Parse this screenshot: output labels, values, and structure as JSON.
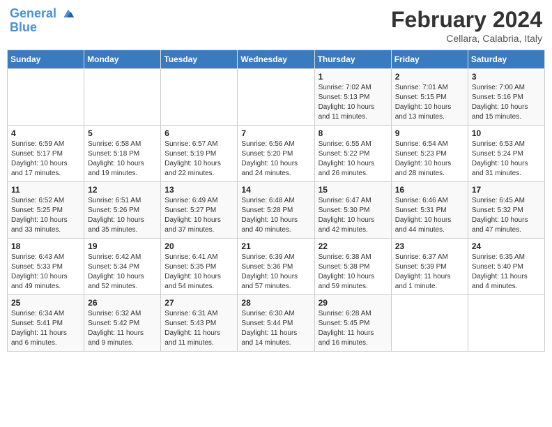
{
  "header": {
    "logo_line1": "General",
    "logo_line2": "Blue",
    "month_title": "February 2024",
    "location": "Cellara, Calabria, Italy"
  },
  "weekdays": [
    "Sunday",
    "Monday",
    "Tuesday",
    "Wednesday",
    "Thursday",
    "Friday",
    "Saturday"
  ],
  "weeks": [
    [
      {
        "day": "",
        "info": ""
      },
      {
        "day": "",
        "info": ""
      },
      {
        "day": "",
        "info": ""
      },
      {
        "day": "",
        "info": ""
      },
      {
        "day": "1",
        "info": "Sunrise: 7:02 AM\nSunset: 5:13 PM\nDaylight: 10 hours\nand 11 minutes."
      },
      {
        "day": "2",
        "info": "Sunrise: 7:01 AM\nSunset: 5:15 PM\nDaylight: 10 hours\nand 13 minutes."
      },
      {
        "day": "3",
        "info": "Sunrise: 7:00 AM\nSunset: 5:16 PM\nDaylight: 10 hours\nand 15 minutes."
      }
    ],
    [
      {
        "day": "4",
        "info": "Sunrise: 6:59 AM\nSunset: 5:17 PM\nDaylight: 10 hours\nand 17 minutes."
      },
      {
        "day": "5",
        "info": "Sunrise: 6:58 AM\nSunset: 5:18 PM\nDaylight: 10 hours\nand 19 minutes."
      },
      {
        "day": "6",
        "info": "Sunrise: 6:57 AM\nSunset: 5:19 PM\nDaylight: 10 hours\nand 22 minutes."
      },
      {
        "day": "7",
        "info": "Sunrise: 6:56 AM\nSunset: 5:20 PM\nDaylight: 10 hours\nand 24 minutes."
      },
      {
        "day": "8",
        "info": "Sunrise: 6:55 AM\nSunset: 5:22 PM\nDaylight: 10 hours\nand 26 minutes."
      },
      {
        "day": "9",
        "info": "Sunrise: 6:54 AM\nSunset: 5:23 PM\nDaylight: 10 hours\nand 28 minutes."
      },
      {
        "day": "10",
        "info": "Sunrise: 6:53 AM\nSunset: 5:24 PM\nDaylight: 10 hours\nand 31 minutes."
      }
    ],
    [
      {
        "day": "11",
        "info": "Sunrise: 6:52 AM\nSunset: 5:25 PM\nDaylight: 10 hours\nand 33 minutes."
      },
      {
        "day": "12",
        "info": "Sunrise: 6:51 AM\nSunset: 5:26 PM\nDaylight: 10 hours\nand 35 minutes."
      },
      {
        "day": "13",
        "info": "Sunrise: 6:49 AM\nSunset: 5:27 PM\nDaylight: 10 hours\nand 37 minutes."
      },
      {
        "day": "14",
        "info": "Sunrise: 6:48 AM\nSunset: 5:28 PM\nDaylight: 10 hours\nand 40 minutes."
      },
      {
        "day": "15",
        "info": "Sunrise: 6:47 AM\nSunset: 5:30 PM\nDaylight: 10 hours\nand 42 minutes."
      },
      {
        "day": "16",
        "info": "Sunrise: 6:46 AM\nSunset: 5:31 PM\nDaylight: 10 hours\nand 44 minutes."
      },
      {
        "day": "17",
        "info": "Sunrise: 6:45 AM\nSunset: 5:32 PM\nDaylight: 10 hours\nand 47 minutes."
      }
    ],
    [
      {
        "day": "18",
        "info": "Sunrise: 6:43 AM\nSunset: 5:33 PM\nDaylight: 10 hours\nand 49 minutes."
      },
      {
        "day": "19",
        "info": "Sunrise: 6:42 AM\nSunset: 5:34 PM\nDaylight: 10 hours\nand 52 minutes."
      },
      {
        "day": "20",
        "info": "Sunrise: 6:41 AM\nSunset: 5:35 PM\nDaylight: 10 hours\nand 54 minutes."
      },
      {
        "day": "21",
        "info": "Sunrise: 6:39 AM\nSunset: 5:36 PM\nDaylight: 10 hours\nand 57 minutes."
      },
      {
        "day": "22",
        "info": "Sunrise: 6:38 AM\nSunset: 5:38 PM\nDaylight: 10 hours\nand 59 minutes."
      },
      {
        "day": "23",
        "info": "Sunrise: 6:37 AM\nSunset: 5:39 PM\nDaylight: 11 hours\nand 1 minute."
      },
      {
        "day": "24",
        "info": "Sunrise: 6:35 AM\nSunset: 5:40 PM\nDaylight: 11 hours\nand 4 minutes."
      }
    ],
    [
      {
        "day": "25",
        "info": "Sunrise: 6:34 AM\nSunset: 5:41 PM\nDaylight: 11 hours\nand 6 minutes."
      },
      {
        "day": "26",
        "info": "Sunrise: 6:32 AM\nSunset: 5:42 PM\nDaylight: 11 hours\nand 9 minutes."
      },
      {
        "day": "27",
        "info": "Sunrise: 6:31 AM\nSunset: 5:43 PM\nDaylight: 11 hours\nand 11 minutes."
      },
      {
        "day": "28",
        "info": "Sunrise: 6:30 AM\nSunset: 5:44 PM\nDaylight: 11 hours\nand 14 minutes."
      },
      {
        "day": "29",
        "info": "Sunrise: 6:28 AM\nSunset: 5:45 PM\nDaylight: 11 hours\nand 16 minutes."
      },
      {
        "day": "",
        "info": ""
      },
      {
        "day": "",
        "info": ""
      }
    ]
  ]
}
